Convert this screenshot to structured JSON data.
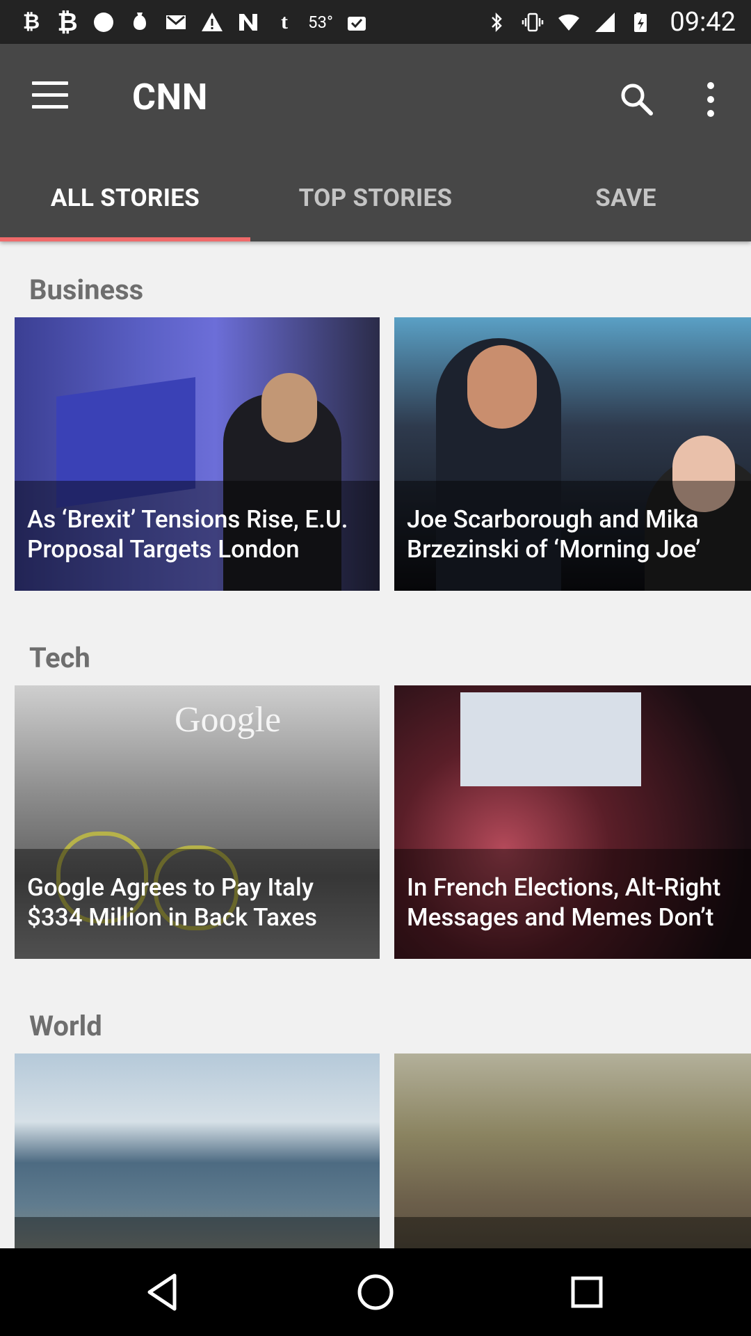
{
  "status_bar": {
    "left_icons": [
      "bitcoin-icon",
      "bitcoin-bold-icon",
      "circle-icon",
      "notification-icon",
      "mail-icon",
      "warning-icon",
      "n-icon",
      "tumblr-icon",
      "weather-icon",
      "clipboard-check-icon"
    ],
    "temperature": "53°",
    "right_icons": [
      "bluetooth-icon",
      "vibrate-icon",
      "wifi-icon",
      "signal-icon",
      "battery-icon"
    ],
    "time": "09:42"
  },
  "app_bar": {
    "title": "CNN",
    "background_color": "#474747"
  },
  "tabs": [
    {
      "label": "ALL STORIES",
      "active": true
    },
    {
      "label": "TOP STORIES",
      "active": false
    },
    {
      "label": "SAVE",
      "active": false
    }
  ],
  "sections": [
    {
      "title": "Business",
      "stories": [
        {
          "headline": "As ‘Brexit’ Tensions Rise, E.U. Proposal Targets London"
        },
        {
          "headline": "Joe Scarborough and Mika Brzezinski of ‘Morning Joe’"
        }
      ]
    },
    {
      "title": "Tech",
      "stories": [
        {
          "headline": "Google Agrees to Pay Italy $334 Million in Back Taxes"
        },
        {
          "headline": "In French Elections, Alt-Right Messages and Memes Don’t"
        }
      ]
    },
    {
      "title": "World",
      "stories": [
        {
          "headline": ""
        },
        {
          "headline": ""
        }
      ]
    }
  ],
  "google_logo_text": "Google",
  "accent_color": "#ef6a6a"
}
